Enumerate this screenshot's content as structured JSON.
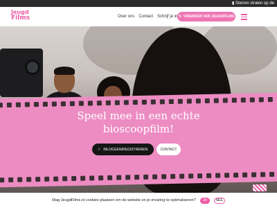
{
  "ticker": {
    "text": "Sterren stralen op de"
  },
  "header": {
    "logo_line1": "Jeugd",
    "logo_line2": "Films",
    "nav": [
      "Over ons",
      "Contact",
      "Schrijf je in"
    ],
    "cta_label": "VRIENDEN VAN JEUGDFILMS",
    "cta_icon": "ticket-icon",
    "menu_icon": "hamburger-icon"
  },
  "hero": {
    "headline_line1": "Speel mee in een echte",
    "headline_line2": "bioscoopfilm!",
    "login_label": "INLOGGEN/REGISTREREN",
    "contact_label": "CONTACT"
  },
  "cookie": {
    "message": "Mag JeugdFilms.nl cookies plaatsen om de website en je ervaring te optimaliseren?",
    "yes_label": "JA",
    "no_label": "NEE"
  },
  "colors": {
    "brand": "#ec5ba5",
    "film_strip": "#ec8cc3",
    "dark_button": "#161616"
  }
}
